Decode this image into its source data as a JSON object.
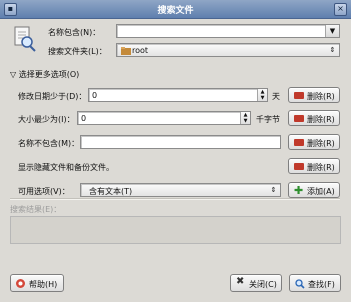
{
  "window": {
    "title": "搜索文件"
  },
  "name_contains": {
    "label": "名称包含(N)：",
    "value": ""
  },
  "search_folder": {
    "label": "搜索文件夹(L)：",
    "value": "root"
  },
  "more_options": {
    "label": "选择更多选项(O)",
    "icon": "triangle-down-icon"
  },
  "options": [
    {
      "label": "修改日期少于(D)：",
      "value": "0",
      "unit": "天",
      "remove": "删除(R)"
    },
    {
      "label": "大小最少为(I)：",
      "value": "0",
      "unit": "千字节",
      "remove": "删除(R)"
    },
    {
      "label": "名称不包含(M)：",
      "value": "",
      "remove": "删除(R)"
    },
    {
      "label": "显示隐藏文件和备份文件。",
      "remove": "删除(R)"
    }
  ],
  "available_options": {
    "label": "可用选项(V)：",
    "selected": "含有文本(T)",
    "add": "添加(A)"
  },
  "results": {
    "label": "搜索结果(E)："
  },
  "footer": {
    "help": "帮助(H)",
    "close": "关闭(C)",
    "find": "查找(F)"
  },
  "colors": {
    "remove_icon": "#c0392b",
    "add_icon": "#2f8f2f",
    "find_icon": "#2a66b5",
    "close_icon": "#333333"
  }
}
